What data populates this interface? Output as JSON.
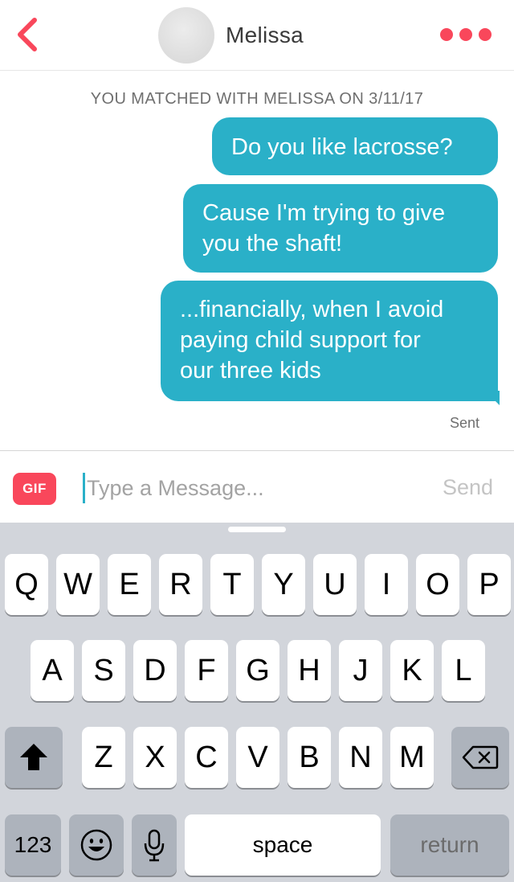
{
  "header": {
    "contact_name": "Melissa",
    "icons": {
      "back": "chevron-left-icon",
      "more": "more-dots-icon",
      "avatar": "avatar"
    }
  },
  "conversation": {
    "match_banner": "YOU MATCHED WITH MELISSA ON 3/11/17",
    "messages": [
      {
        "lines": [
          "Do you like lacrosse?"
        ]
      },
      {
        "lines": [
          "Cause I'm trying to give",
          "you the shaft!"
        ]
      },
      {
        "lines": [
          "...financially, when I avoid",
          "paying child support for",
          "our three kids"
        ]
      }
    ],
    "status": "Sent"
  },
  "compose": {
    "gif_label": "GIF",
    "placeholder": "Type a Message...",
    "value": "",
    "send_label": "Send"
  },
  "keyboard": {
    "row1": [
      "Q",
      "W",
      "E",
      "R",
      "T",
      "Y",
      "U",
      "I",
      "O",
      "P"
    ],
    "row2": [
      "A",
      "S",
      "D",
      "F",
      "G",
      "H",
      "J",
      "K",
      "L"
    ],
    "row3": [
      "Z",
      "X",
      "C",
      "V",
      "B",
      "N",
      "M"
    ],
    "numbers_label": "123",
    "space_label": "space",
    "return_label": "return",
    "icons": {
      "shift": "shift-icon",
      "delete": "backspace-icon",
      "emoji": "emoji-icon",
      "mic": "microphone-icon"
    }
  },
  "colors": {
    "accent": "#f9475b",
    "bubble": "#2ab0c8",
    "keyboard_bg": "#d2d5db",
    "special_key": "#adb3bc"
  }
}
